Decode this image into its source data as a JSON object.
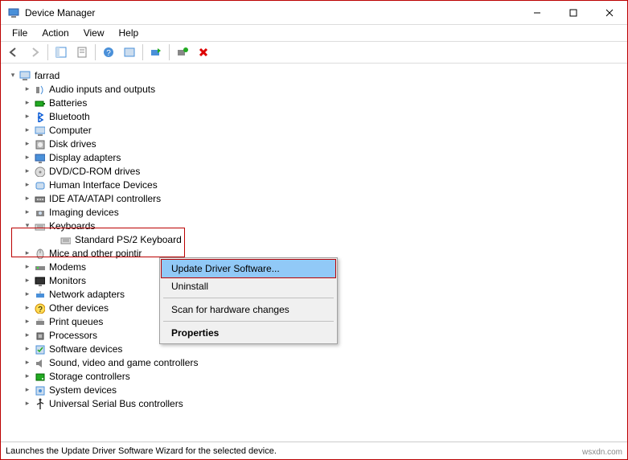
{
  "window": {
    "title": "Device Manager"
  },
  "menu": {
    "file": "File",
    "action": "Action",
    "view": "View",
    "help": "Help"
  },
  "tree": {
    "root": "farrad",
    "items": [
      {
        "label": "Audio inputs and outputs",
        "icon": "audio"
      },
      {
        "label": "Batteries",
        "icon": "battery"
      },
      {
        "label": "Bluetooth",
        "icon": "bluetooth"
      },
      {
        "label": "Computer",
        "icon": "computer"
      },
      {
        "label": "Disk drives",
        "icon": "disk"
      },
      {
        "label": "Display adapters",
        "icon": "display"
      },
      {
        "label": "DVD/CD-ROM drives",
        "icon": "cdrom"
      },
      {
        "label": "Human Interface Devices",
        "icon": "hid"
      },
      {
        "label": "IDE ATA/ATAPI controllers",
        "icon": "ide"
      },
      {
        "label": "Imaging devices",
        "icon": "imaging"
      },
      {
        "label": "Keyboards",
        "icon": "keyboard",
        "expanded": true,
        "children": [
          {
            "label": "Standard PS/2 Keyboard",
            "icon": "keyboard"
          }
        ]
      },
      {
        "label": "Mice and other pointir",
        "icon": "mouse"
      },
      {
        "label": "Modems",
        "icon": "modem"
      },
      {
        "label": "Monitors",
        "icon": "monitor"
      },
      {
        "label": "Network adapters",
        "icon": "network"
      },
      {
        "label": "Other devices",
        "icon": "other"
      },
      {
        "label": "Print queues",
        "icon": "printer"
      },
      {
        "label": "Processors",
        "icon": "cpu"
      },
      {
        "label": "Software devices",
        "icon": "software"
      },
      {
        "label": "Sound, video and game controllers",
        "icon": "sound"
      },
      {
        "label": "Storage controllers",
        "icon": "storage"
      },
      {
        "label": "System devices",
        "icon": "system"
      },
      {
        "label": "Universal Serial Bus controllers",
        "icon": "usb"
      }
    ]
  },
  "context": {
    "update": "Update Driver Software...",
    "uninstall": "Uninstall",
    "scan": "Scan for hardware changes",
    "properties": "Properties"
  },
  "status": "Launches the Update Driver Software Wizard for the selected device.",
  "watermark": "wsxdn.com"
}
